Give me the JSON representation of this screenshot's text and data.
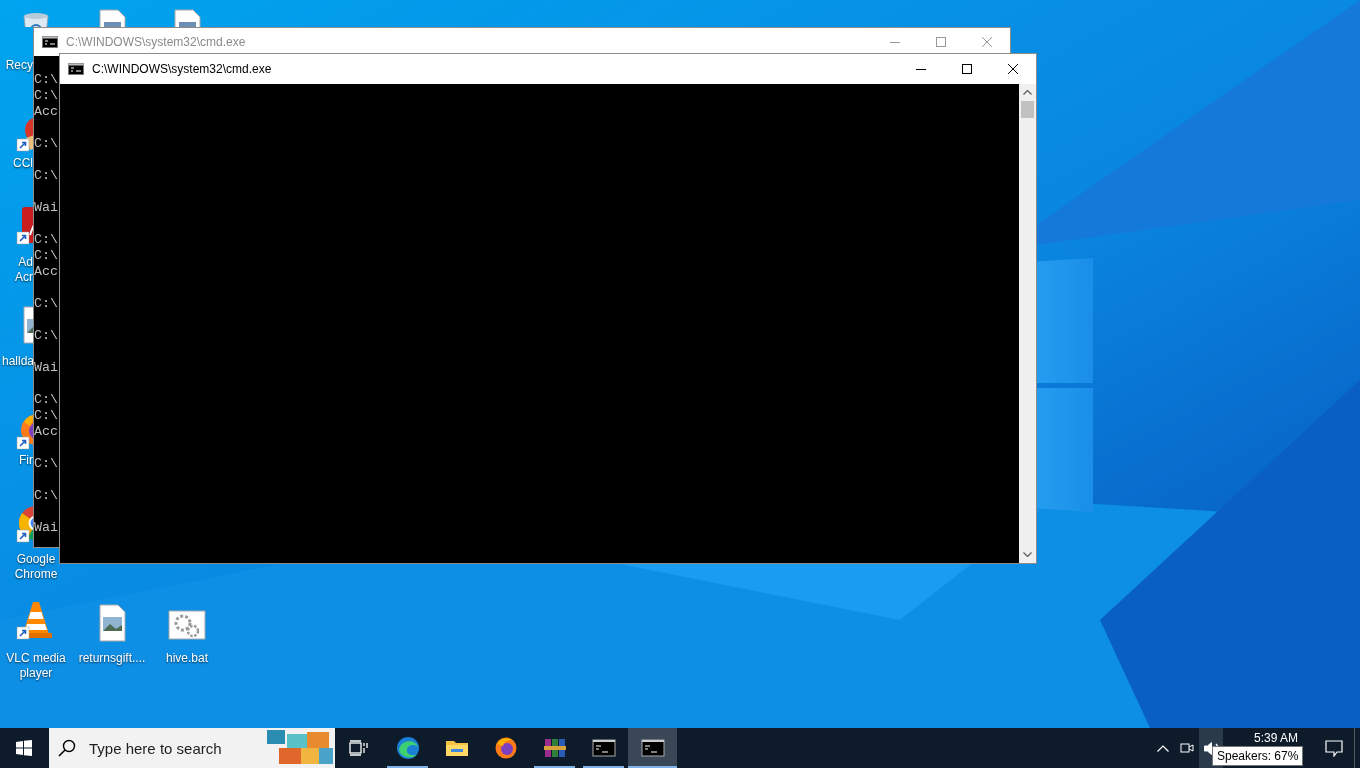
{
  "desktop_icons": [
    {
      "kind": "recycle-bin",
      "label_lines": [
        "Recy"
      ]
    },
    {
      "kind": "document"
    },
    {
      "kind": "document"
    },
    {
      "kind": "cleaner",
      "label_lines": [
        "CCl"
      ],
      "shortcut": true
    },
    {
      "kind": "pdf-reader",
      "label_lines": [
        "Ad",
        "Acr"
      ],
      "shortcut": true
    },
    {
      "kind": "image-file",
      "label_lines": [
        "hallda"
      ],
      "shortcut": false
    },
    {
      "kind": "firefox",
      "label_lines": [
        "Fir"
      ],
      "shortcut": true
    },
    {
      "kind": "chrome",
      "label_lines": [
        "Google",
        "Chrome"
      ],
      "shortcut": true
    },
    {
      "kind": "vlc",
      "label_lines": [
        "VLC media",
        "player"
      ],
      "shortcut": true
    },
    {
      "kind": "image-file",
      "label_lines": [
        "returnsgift...."
      ],
      "shortcut": false
    },
    {
      "kind": "batch-file",
      "label_lines": [
        "hive.bat"
      ],
      "shortcut": false
    }
  ],
  "windows": [
    {
      "title": "C:\\WINDOWS\\system32\\cmd.exe",
      "active": false,
      "console_blocks": [
        [
          "C:\\",
          "C:\\",
          "Acc"
        ],
        [
          "C:\\"
        ],
        [
          "C:\\"
        ],
        [
          "Wai"
        ],
        [
          "C:\\",
          "C:\\",
          "Acc"
        ],
        [
          "C:\\"
        ],
        [
          "C:\\"
        ],
        [
          "Wai"
        ],
        [
          "C:\\",
          "C:\\",
          "Acc"
        ],
        [
          "C:\\"
        ],
        [
          "C:\\"
        ],
        [
          "Wai"
        ]
      ]
    },
    {
      "title": "C:\\WINDOWS\\system32\\cmd.exe",
      "active": true
    }
  ],
  "taskbar": {
    "search": {
      "placeholder": "Type here to search"
    },
    "apps": [
      {
        "kind": "edge",
        "running": true,
        "selected": false
      },
      {
        "kind": "explorer",
        "running": false,
        "selected": false
      },
      {
        "kind": "firefox",
        "running": false,
        "selected": false
      },
      {
        "kind": "winrar",
        "running": true,
        "selected": false
      },
      {
        "kind": "cmd",
        "running": true,
        "selected": false
      },
      {
        "kind": "cmd",
        "running": true,
        "selected": true
      }
    ],
    "clock": {
      "time": "5:39 AM"
    },
    "tooltip": "Speakers: 67%"
  }
}
